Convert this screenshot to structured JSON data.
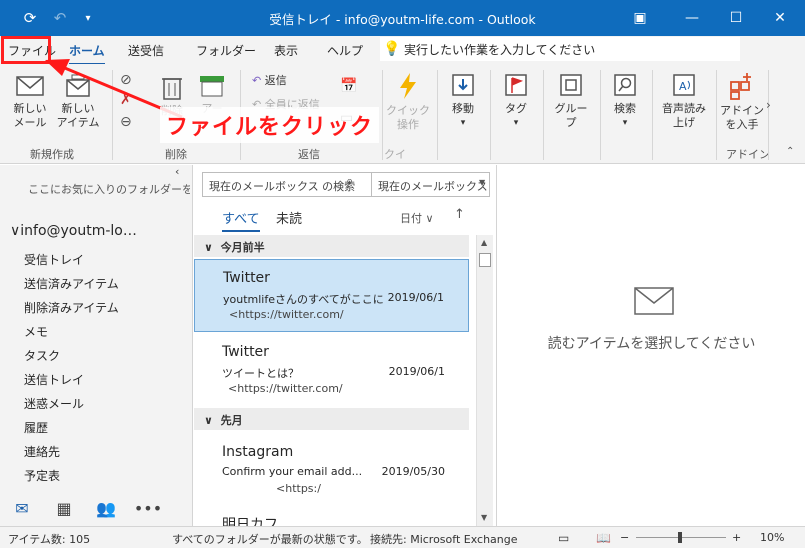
{
  "titlebar": {
    "title": "受信トレイ - info@youtm-life.com - Outlook",
    "window_controls": [
      "minimize",
      "restore",
      "close"
    ]
  },
  "tabs": [
    "ファイル",
    "ホーム",
    "送受信",
    "フォルダー",
    "表示",
    "ヘルプ"
  ],
  "active_tab": "ホーム",
  "tellme": {
    "placeholder": "実行したい作業を入力してください"
  },
  "ribbon": {
    "new_mail": "新しい\nメール",
    "new_items": "新しい\nアイテム",
    "delete": "削除",
    "archive": "アー",
    "reply": "返信",
    "reply_all": "全員に返信",
    "quick_steps": "クイック\n操作",
    "move": "移動",
    "tags": "タグ",
    "groups": "グルー\nプ",
    "find": "検索",
    "read_aloud": "音声読み\n上げ",
    "addins": "アドイン\nを入手",
    "group_new": "新規作成",
    "group_delete": "削除",
    "group_respond": "返信",
    "group_quick": "クイ",
    "group_addins": "アドイン"
  },
  "annotation": {
    "text": "ファイルをクリック",
    "color": "#ff1a1a"
  },
  "folderpane": {
    "fav_hint": "ここにお気に入りのフォルダーをドラッグ",
    "account": "info@youtm-lo…",
    "folders": [
      "受信トレイ",
      "送信済みアイテム",
      "削除済みアイテム",
      "メモ",
      "タスク",
      "送信トレイ",
      "迷惑メール",
      "履歴",
      "連絡先",
      "予定表"
    ]
  },
  "navbar": [
    "mail-icon",
    "calendar-icon",
    "people-icon",
    "more-icon"
  ],
  "msglist": {
    "search_placeholder": "現在のメールボックス の検索",
    "scope": "現在のメールボックス",
    "filter_all": "すべて",
    "filter_unread": "未読",
    "sort": "日付",
    "groups": [
      {
        "header": "今月前半",
        "messages": [
          {
            "sender": "Twitter",
            "subject": "youtmlifeさんのすべてがここに",
            "date": "2019/06/1",
            "preview": "<https://twitter.com/",
            "selected": true
          },
          {
            "sender": "Twitter",
            "subject": "ツイートとは？",
            "date": "2019/06/1",
            "preview": "<https://twitter.com/",
            "selected": false
          }
        ]
      },
      {
        "header": "先月",
        "messages": [
          {
            "sender": "Instagram",
            "subject": "Confirm your email add...",
            "date": "2019/05/30",
            "preview": "<https:/",
            "selected": false
          }
        ]
      }
    ],
    "partial_item": "明日カフ"
  },
  "reading": {
    "placeholder": "読むアイテムを選択してください"
  },
  "status": {
    "items": "アイテム数: 105",
    "sync": "すべてのフォルダーが最新の状態です。",
    "connection": "接続先: Microsoft Exchange",
    "zoom": "10%"
  },
  "colors": {
    "accent": "#0f6cbd",
    "selection": "#cce4f7",
    "annotation": "#ff1a1a"
  }
}
